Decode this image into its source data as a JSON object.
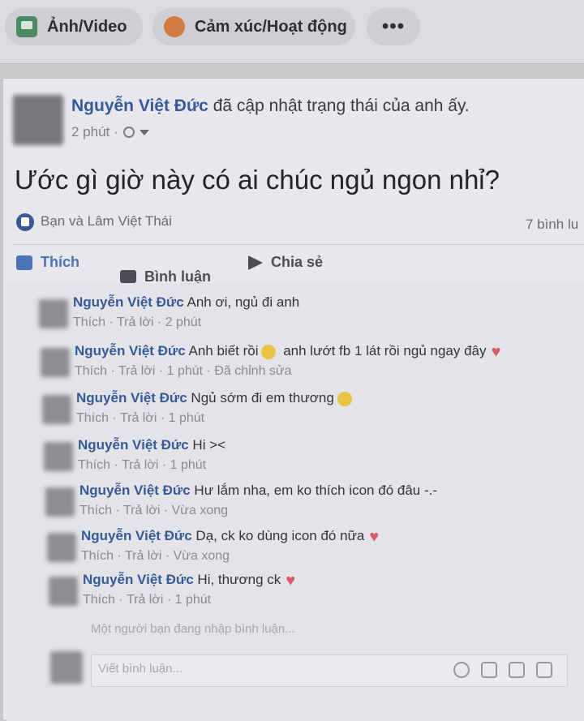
{
  "composer_bar": {
    "photo_label": "Ảnh/Video",
    "feeling_label": "Cảm xúc/Hoạt động",
    "more_label": "•••"
  },
  "post": {
    "author": "Nguyễn Việt Đức",
    "action": " đã cập nhật trạng thái của anh ấy.",
    "time": "2 phút ·",
    "status": "Ước gì giờ này có ai chúc ngủ ngon nhỉ?",
    "likes": "Bạn và Lâm Việt Thái",
    "comments_count": "7 bình lu",
    "actions": {
      "like": "Thích",
      "comment": "Bình luận",
      "share": "Chia sẻ"
    }
  },
  "comments": [
    {
      "author": "Nguyễn Việt Đức",
      "text": " Anh ơi, ngủ đi anh",
      "meta": "Thích · Trả lời · 2 phút"
    },
    {
      "author": "Nguyễn Việt Đức",
      "text": " Anh biết rồi",
      "text_after": " anh lướt fb 1 lát rồi ngủ ngay đây",
      "meta": "Thích · Trả lời · 1 phút · Đã chỉnh sửa"
    },
    {
      "author": "Nguyễn Việt Đức",
      "text": " Ngủ sớm đi em thương",
      "meta": "Thích · Trả lời · 1 phút"
    },
    {
      "author": "Nguyễn Việt Đức",
      "text": " Hi ><",
      "meta": "Thích · Trả lời · 1 phút"
    },
    {
      "author": "Nguyễn Việt Đức",
      "text": " Hư lắm nha, em ko thích icon đó đâu -.-",
      "meta": "Thích · Trả lời · Vừa xong"
    },
    {
      "author": "Nguyễn Việt Đức",
      "text": " Dạ, ck ko dùng icon đó nữa",
      "meta": "Thích · Trả lời · Vừa xong"
    },
    {
      "author": "Nguyễn Việt Đức",
      "text": " Hi, thương ck",
      "meta": "Thích · Trả lời · 1 phút"
    }
  ],
  "typing_indicator": "Một người bạn đang nhập bình luận...",
  "composer": {
    "placeholder": "Viết bình luận..."
  },
  "colors": {
    "link_blue": "#365a9a",
    "like_blue": "#4a74b5",
    "heart_red": "#d95b6b"
  }
}
